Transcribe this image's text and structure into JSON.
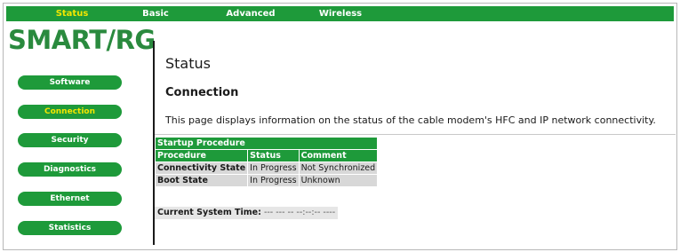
{
  "topnav": {
    "tabs": [
      {
        "label": "Status",
        "active": true
      },
      {
        "label": "Basic",
        "active": false
      },
      {
        "label": "Advanced",
        "active": false
      },
      {
        "label": "Wireless",
        "active": false
      }
    ]
  },
  "logo": {
    "text": "SMART/RG"
  },
  "sidebar": {
    "items": [
      {
        "label": "Software",
        "active": false
      },
      {
        "label": "Connection",
        "active": true
      },
      {
        "label": "Security",
        "active": false
      },
      {
        "label": "Diagnostics",
        "active": false
      },
      {
        "label": "Ethernet",
        "active": false
      },
      {
        "label": "Statistics",
        "active": false
      }
    ]
  },
  "content": {
    "page_title": "Status",
    "section_title": "Connection",
    "description": "This page displays information on the status of the cable modem's HFC and IP network connectivity."
  },
  "startup_table": {
    "title": "Startup Procedure",
    "headers": [
      "Procedure",
      "Status",
      "Comment"
    ],
    "rows": [
      {
        "procedure": "Connectivity State",
        "status": "In Progress",
        "comment": "Not Synchronized"
      },
      {
        "procedure": "Boot State",
        "status": "In Progress",
        "comment": "Unknown"
      }
    ]
  },
  "system_time": {
    "label": "Current System Time:",
    "value": "--- --- -- --:--:-- ----"
  },
  "colors": {
    "brand_green": "#1e9a3a",
    "active_yellow": "#f2e600",
    "logo_green": "#2a8a3e",
    "cell_gray": "#d8d8d8"
  }
}
